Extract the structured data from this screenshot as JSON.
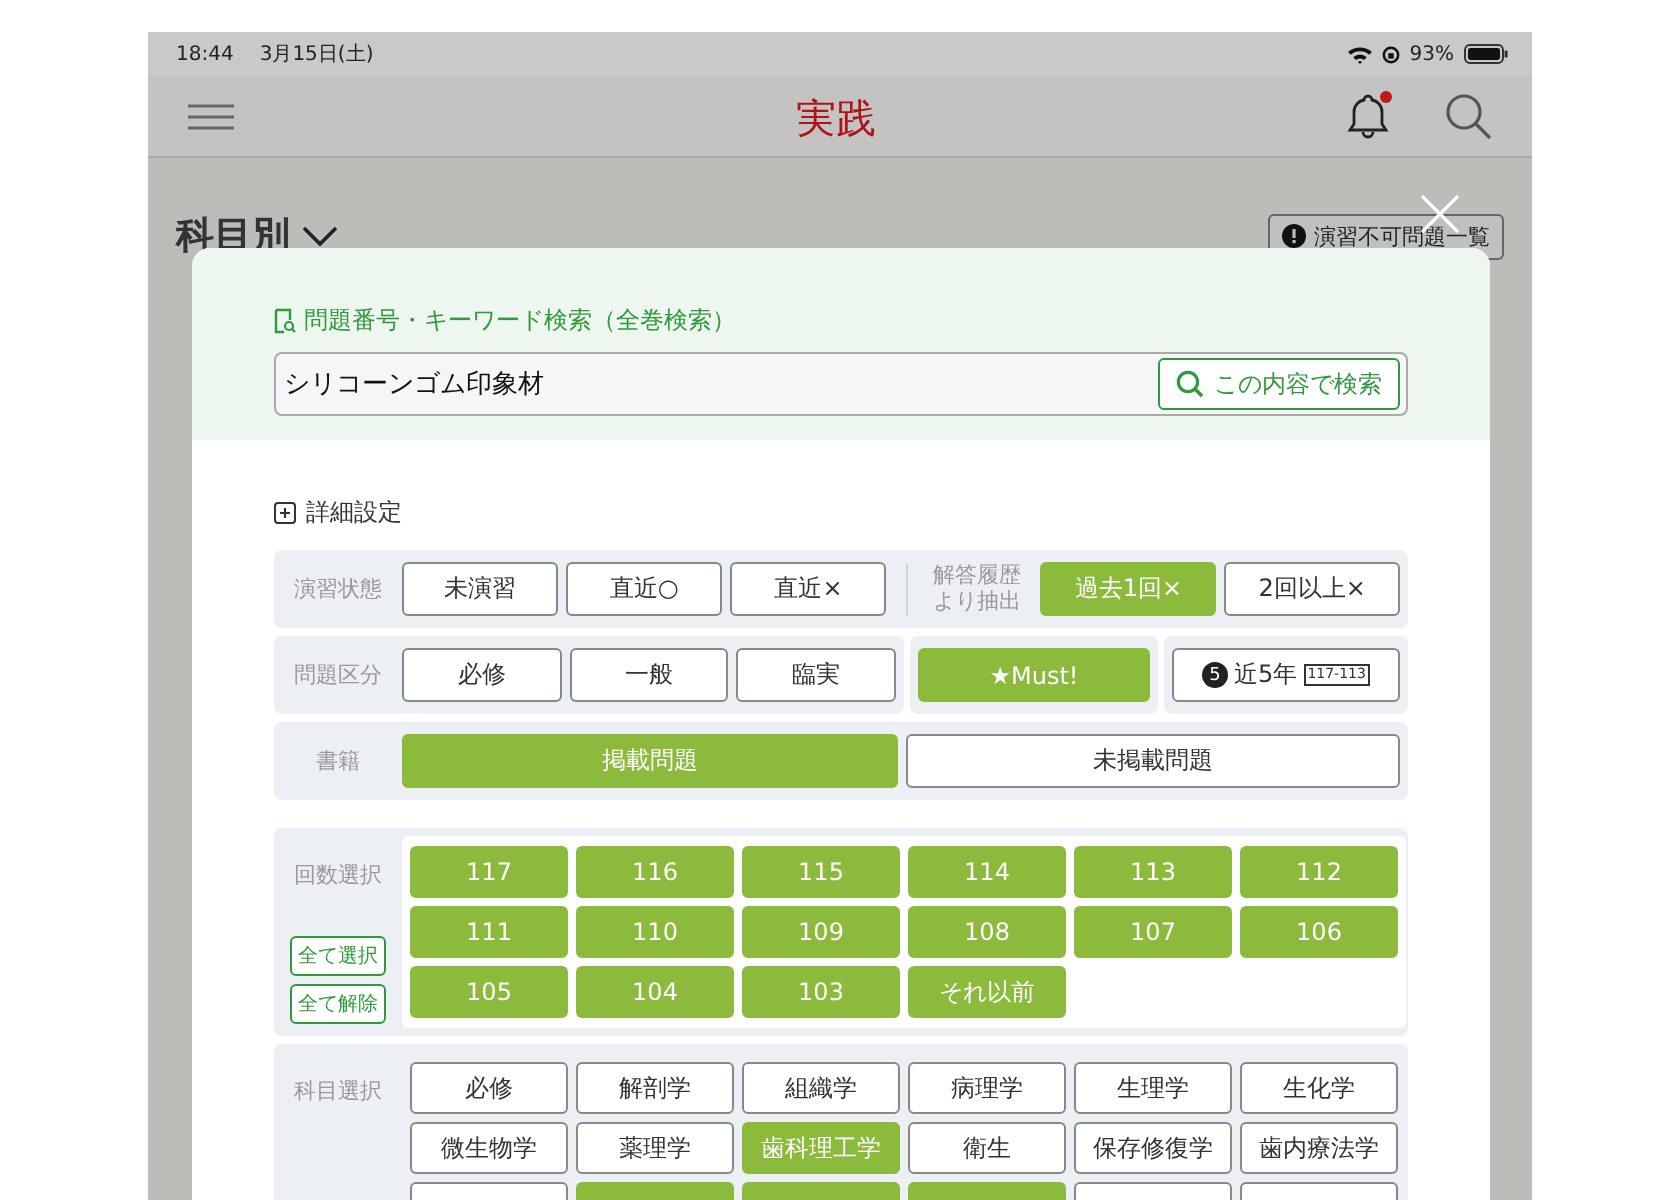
{
  "status_bar": {
    "time": "18:44",
    "date": "3月15日(土)",
    "battery": "93%"
  },
  "header": {
    "title": "実践",
    "notification_badge": true
  },
  "page": {
    "heading": "科目別",
    "unavailable_button": "演習不可問題一覧"
  },
  "modal": {
    "search": {
      "label": "問題番号・キーワード検索（全巻検索）",
      "value": "シリコーンゴム印象材",
      "button": "この内容で検索"
    },
    "details": {
      "label": "詳細設定",
      "expanded": false
    },
    "practice_state": {
      "label": "演習状態",
      "options": [
        {
          "label": "未演習",
          "selected": false
        },
        {
          "label": "直近○",
          "selected": false
        },
        {
          "label": "直近×",
          "selected": false
        }
      ]
    },
    "history": {
      "label": "解答履歴より抽出",
      "options": [
        {
          "label": "過去1回×",
          "selected": true
        },
        {
          "label": "2回以上×",
          "selected": false
        }
      ]
    },
    "category": {
      "label": "問題区分",
      "options": [
        {
          "label": "必修",
          "selected": false
        },
        {
          "label": "一般",
          "selected": false
        },
        {
          "label": "臨実",
          "selected": false
        }
      ]
    },
    "must": {
      "label": "★Must!",
      "selected": true
    },
    "recent": {
      "badge": "5",
      "label": "近5年",
      "range": "117-113",
      "selected": false
    },
    "books": {
      "label": "書籍",
      "options": [
        {
          "label": "掲載問題",
          "selected": true
        },
        {
          "label": "未掲載問題",
          "selected": false
        }
      ]
    },
    "exam_rounds": {
      "label": "回数選択",
      "select_all": "全て選択",
      "clear_all": "全て解除",
      "options": [
        {
          "label": "117",
          "selected": true
        },
        {
          "label": "116",
          "selected": true
        },
        {
          "label": "115",
          "selected": true
        },
        {
          "label": "114",
          "selected": true
        },
        {
          "label": "113",
          "selected": true
        },
        {
          "label": "112",
          "selected": true
        },
        {
          "label": "111",
          "selected": true
        },
        {
          "label": "110",
          "selected": true
        },
        {
          "label": "109",
          "selected": true
        },
        {
          "label": "108",
          "selected": true
        },
        {
          "label": "107",
          "selected": true
        },
        {
          "label": "106",
          "selected": true
        },
        {
          "label": "105",
          "selected": true
        },
        {
          "label": "104",
          "selected": true
        },
        {
          "label": "103",
          "selected": true
        },
        {
          "label": "それ以前",
          "selected": true
        }
      ]
    },
    "subjects": {
      "label": "科目選択",
      "options": [
        {
          "label": "必修",
          "selected": false
        },
        {
          "label": "解剖学",
          "selected": false
        },
        {
          "label": "組織学",
          "selected": false
        },
        {
          "label": "病理学",
          "selected": false
        },
        {
          "label": "生理学",
          "selected": false
        },
        {
          "label": "生化学",
          "selected": false
        },
        {
          "label": "微生物学",
          "selected": false
        },
        {
          "label": "薬理学",
          "selected": false
        },
        {
          "label": "歯科理工学",
          "selected": true
        },
        {
          "label": "衛生",
          "selected": false
        },
        {
          "label": "保存修復学",
          "selected": false
        },
        {
          "label": "歯内療法学",
          "selected": false
        }
      ],
      "cut_row": [
        {
          "selected": false
        },
        {
          "selected": true
        },
        {
          "selected": true
        },
        {
          "selected": true
        },
        {
          "selected": false
        },
        {
          "selected": false
        }
      ]
    }
  }
}
